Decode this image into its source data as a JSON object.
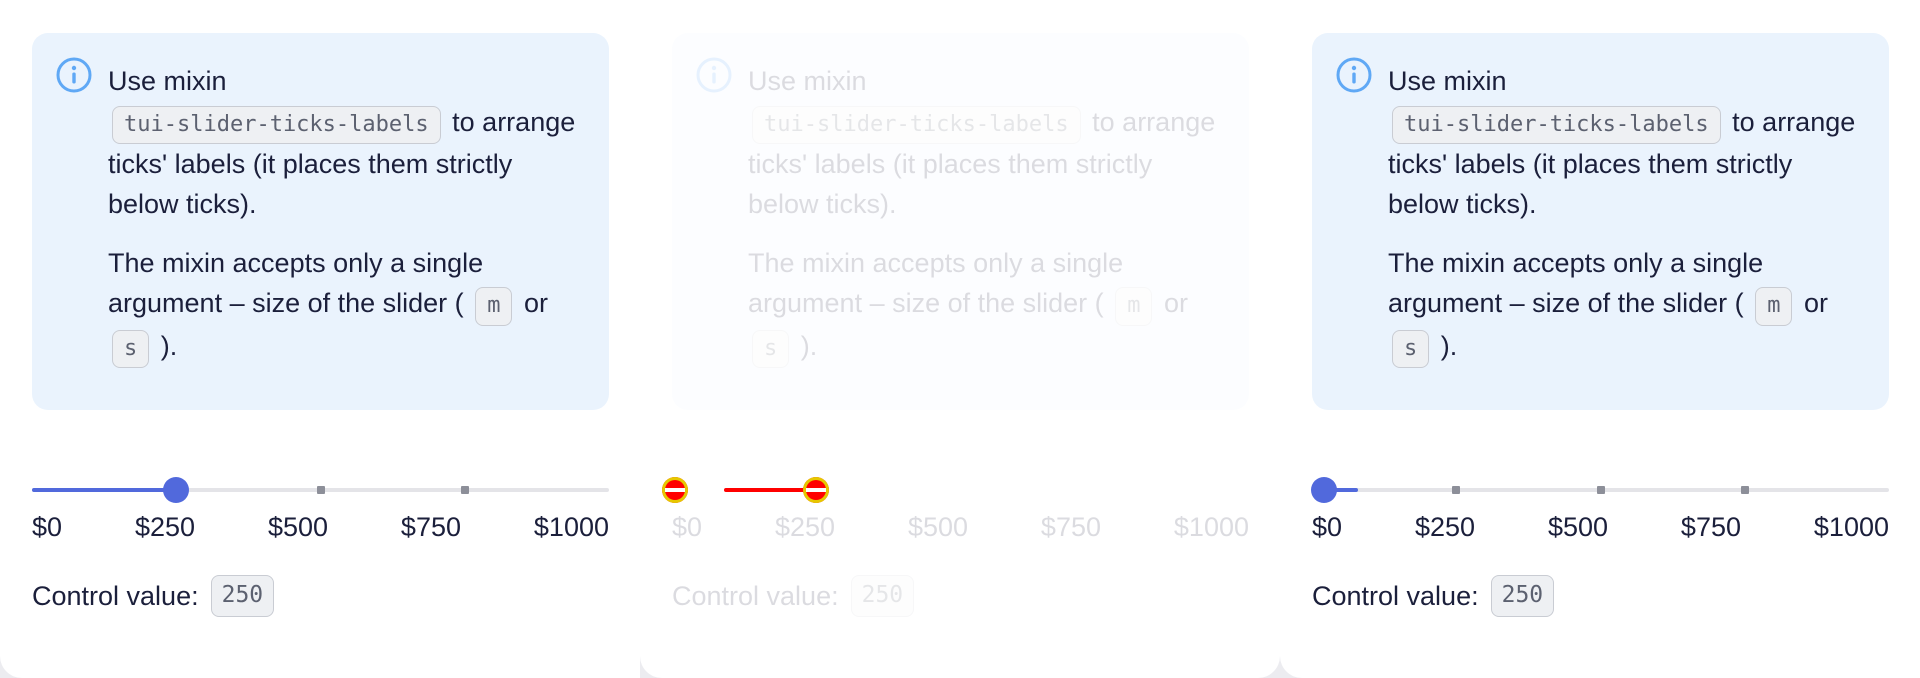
{
  "notice": {
    "line1": "Use mixin",
    "mixin_code": "tui-slider-ticks-labels",
    "after_code": "to arrange ticks' labels (it places them strictly below ticks).",
    "para2_text": "The mixin accepts only a single argument – size of the slider (",
    "size_m": "m",
    "or_word": "or",
    "size_s": "s",
    "para2_end": ")."
  },
  "slider": {
    "min": 0,
    "max": 1000,
    "tick_labels": [
      "$0",
      "$250",
      "$500",
      "$750",
      "$1000"
    ],
    "value": 250,
    "accent_color": "#5169dc"
  },
  "control": {
    "label": "Control value:",
    "value": "250"
  },
  "panels": [
    {
      "state": "default",
      "thumb_value": 250
    },
    {
      "state": "faded-overlay",
      "thumb_value": 250
    },
    {
      "state": "default",
      "thumb_value": 0
    }
  ]
}
